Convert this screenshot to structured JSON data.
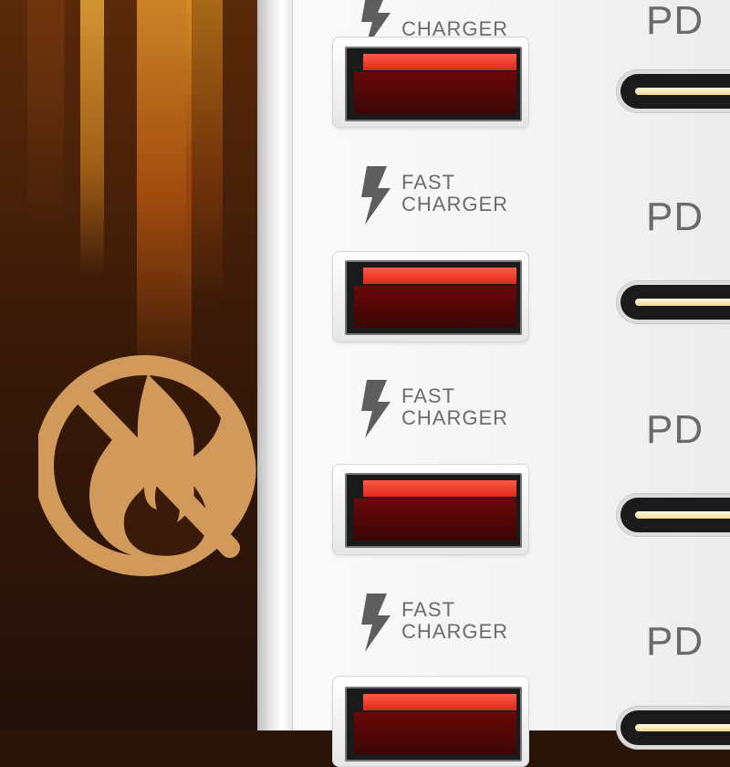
{
  "scene": {
    "icons": {
      "left_badge": "no-fire-icon",
      "bolt": "lightning-bolt-icon"
    },
    "colors": {
      "port_glow": "#ff3b2a",
      "charger_white": "#f4f4f4",
      "label_gray": "#6c6c6c",
      "badge_gold": "#d29a5a"
    }
  },
  "ports": [
    {
      "fast": "",
      "charger": "CHARGER",
      "pd": "PD"
    },
    {
      "fast": "FAST",
      "charger": "CHARGER",
      "pd": "PD"
    },
    {
      "fast": "FAST",
      "charger": "CHARGER",
      "pd": "PD"
    },
    {
      "fast": "FAST",
      "charger": "CHARGER",
      "pd": "PD"
    }
  ]
}
